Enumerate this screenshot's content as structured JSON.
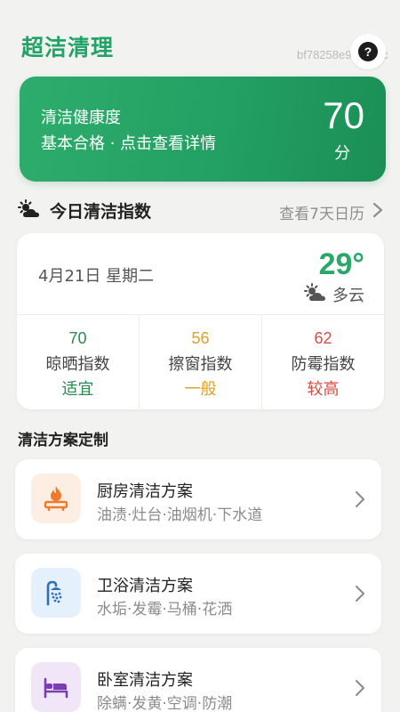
{
  "header": {
    "app_title": "超洁清理",
    "device_id": "bf78258e9d⁠…12c",
    "help_label": "?"
  },
  "health": {
    "title": "清洁健康度",
    "subtitle": "基本合格 · 点击查看详情",
    "score": "70",
    "unit": "分"
  },
  "today": {
    "title": "今日清洁指数",
    "calendar_link": "查看7天日历",
    "date": "4月21日 星期二",
    "temperature": "29°",
    "condition": "多云",
    "indices": [
      {
        "value": "70",
        "name": "晾晒指数",
        "level": "适宜",
        "color": "#2a8a4f"
      },
      {
        "value": "56",
        "name": "擦窗指数",
        "level": "一般",
        "color": "#e0a020"
      },
      {
        "value": "62",
        "name": "防霉指数",
        "level": "较高",
        "color": "#d94b43"
      }
    ]
  },
  "plans": {
    "title": "清洁方案定制",
    "items": [
      {
        "name": "厨房清洁方案",
        "tags": "油渍·灶台·油烟机·下水道",
        "icon": "stove-fire-icon",
        "icon_bg": "#fdeee3"
      },
      {
        "name": "卫浴清洁方案",
        "tags": "水垢·发霉·马桶·花洒",
        "icon": "shower-icon",
        "icon_bg": "#e4f0fb"
      },
      {
        "name": "卧室清洁方案",
        "tags": "除螨·发黄·空调·防潮",
        "icon": "bed-icon",
        "icon_bg": "#f0e6f8"
      }
    ]
  },
  "colors": {
    "brand_green": "#24a368",
    "index_green": "#2a8a4f",
    "index_orange": "#e0a020",
    "index_red": "#d94b43"
  }
}
